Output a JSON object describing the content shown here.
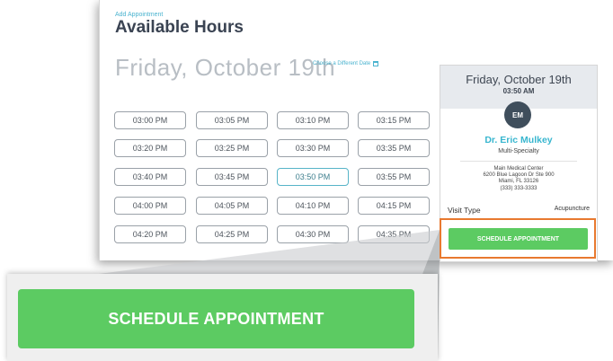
{
  "header": {
    "breadcrumb": "Add Appointment",
    "title": "Available Hours"
  },
  "date_heading": "Friday, October 19th",
  "change_date_label": "Choose a Different Date",
  "time_slots": [
    "03:00 PM",
    "03:05 PM",
    "03:10 PM",
    "03:15 PM",
    "03:20 PM",
    "03:25 PM",
    "03:30 PM",
    "03:35 PM",
    "03:40 PM",
    "03:45 PM",
    "03:50 PM",
    "03:55 PM",
    "04:00 PM",
    "04:05 PM",
    "04:10 PM",
    "04:15 PM",
    "04:20 PM",
    "04:25 PM",
    "04:30 PM",
    "04:35 PM"
  ],
  "selected_slot": "03:50 PM",
  "summary": {
    "date": "Friday, October 19th",
    "time": "03:50 AM",
    "doctor_initials": "EM",
    "doctor_name": "Dr. Eric Mulkey",
    "specialty": "Multi-Specialty",
    "location_name": "Main Medical Center",
    "address_line1": "6200 Blue Lagoon Dr Ste 900",
    "address_line2": "Miami, FL 33126",
    "phone": "(333) 333-3333",
    "visit_type_label": "Visit Type",
    "visit_type_value": "Acupuncture",
    "schedule_button": "SCHEDULE APPOINTMENT"
  },
  "zoom": {
    "button_label": "SCHEDULE APPOINTMENT"
  },
  "colors": {
    "accent": "#4ab3cf",
    "button_green": "#5ccb62",
    "highlight_orange": "#e8792f",
    "avatar_bg": "#3f4e5c"
  },
  "icons": {
    "calendar": "calendar-icon"
  }
}
